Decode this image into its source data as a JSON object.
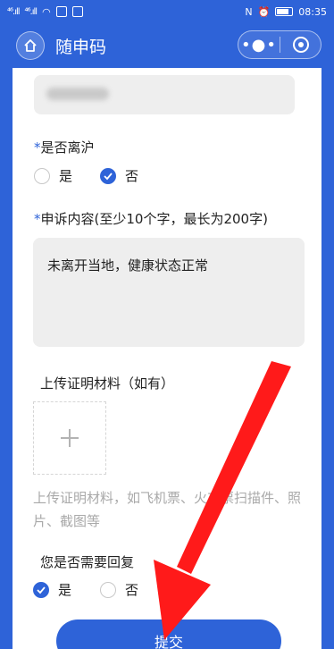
{
  "statusbar": {
    "left_signal_1": "⁴⁶.ıll",
    "left_signal_2": "⁴⁶.ıll",
    "nfc": "N",
    "time": "08:35"
  },
  "navbar": {
    "title": "随申码",
    "more_glyph": "•●•"
  },
  "form": {
    "left_shanghai": {
      "required_mark": "*",
      "label": "是否离沪",
      "options": [
        "是",
        "否"
      ],
      "selected": "否"
    },
    "appeal": {
      "required_mark": "*",
      "label": "申诉内容(至少10个字，最长为200字)",
      "value": "未离开当地，健康状态正常"
    },
    "upload": {
      "label": "上传证明材料（如有）",
      "add_glyph": "+",
      "hint": "上传证明材料，如飞机票、火车票扫描件、照片、截图等"
    },
    "reply": {
      "label": "您是否需要回复",
      "options": [
        "是",
        "否"
      ],
      "selected": "是"
    },
    "submit_label": "提交"
  },
  "colors": {
    "brand": "#2e63d8",
    "annotation_arrow": "#ff1a1a"
  }
}
